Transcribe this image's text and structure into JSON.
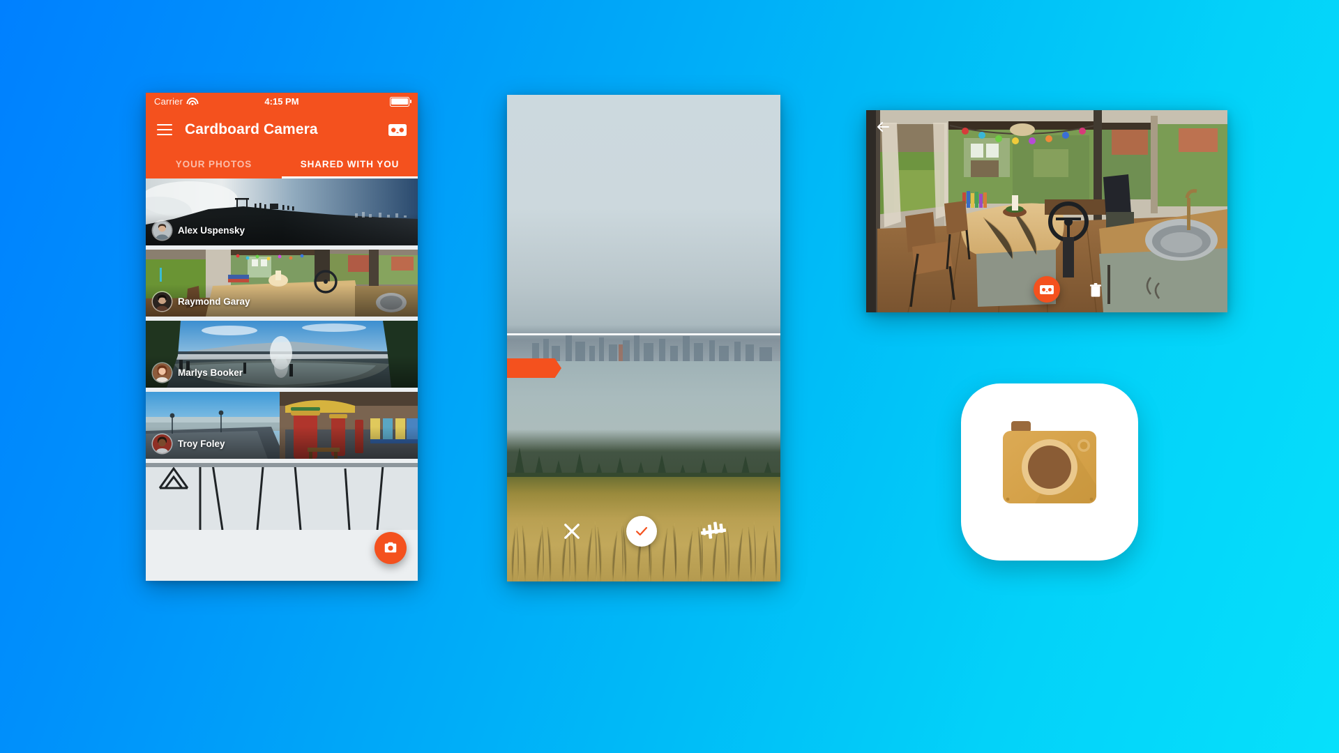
{
  "background": {
    "gradient_from": "#0080ff",
    "gradient_to": "#06e0fb"
  },
  "theme": {
    "accent": "#f4511e",
    "appbar_text": "#ffffff"
  },
  "phone": {
    "status_bar": {
      "carrier": "Carrier",
      "wifi_icon": "wifi-icon",
      "time": "4:15 PM",
      "battery_icon": "battery-full-icon"
    },
    "app_bar": {
      "menu_icon": "hamburger-menu-icon",
      "title": "Cardboard Camera",
      "action_icon": "cardboard-vr-icon"
    },
    "tabs": [
      {
        "label": "YOUR PHOTOS",
        "active": false
      },
      {
        "label": "SHARED WITH YOU",
        "active": true
      }
    ],
    "photos": [
      {
        "author": "Alex Uspensky",
        "scene": "mountain-summit-above-clouds"
      },
      {
        "author": "Raymond Garay",
        "scene": "camper-van-interior"
      },
      {
        "author": "Marlys Booker",
        "scene": "geyser-waterfall-landscape"
      },
      {
        "author": "Troy Foley",
        "scene": "seaside-boardwalk-columns"
      },
      {
        "author": "",
        "scene": "bridge-truss-partial"
      }
    ],
    "fab": {
      "icon": "camera-icon",
      "label": "Capture photo",
      "color": "#f4511e"
    }
  },
  "capture": {
    "scene": "bay-skyline-over-grass-field",
    "progress_indicator": {
      "icon": "capture-progress-arrow",
      "color": "#f4511e"
    },
    "horizon_guide": "white-horizon-line",
    "controls": [
      {
        "name": "cancel",
        "icon": "close-x-icon",
        "label": "Cancel"
      },
      {
        "name": "accept",
        "icon": "check-icon",
        "label": "Done"
      },
      {
        "name": "level",
        "icon": "tilt-level-icon",
        "label": "Level"
      }
    ]
  },
  "vr_viewer": {
    "scene": "camper-van-interior",
    "back_icon": "arrow-back-icon",
    "vr_button": {
      "icon": "cardboard-vr-icon",
      "label": "View in VR",
      "color": "#f4511e"
    },
    "delete_button": {
      "icon": "trash-icon",
      "label": "Delete"
    }
  },
  "app_icon": {
    "name": "Cardboard Camera",
    "icon": "cardboard-camera-app-icon",
    "body_color": "#d6a14a",
    "lens_color": "#8a5c35",
    "lens_ring_color": "#e8c68a",
    "background": "#ffffff"
  }
}
